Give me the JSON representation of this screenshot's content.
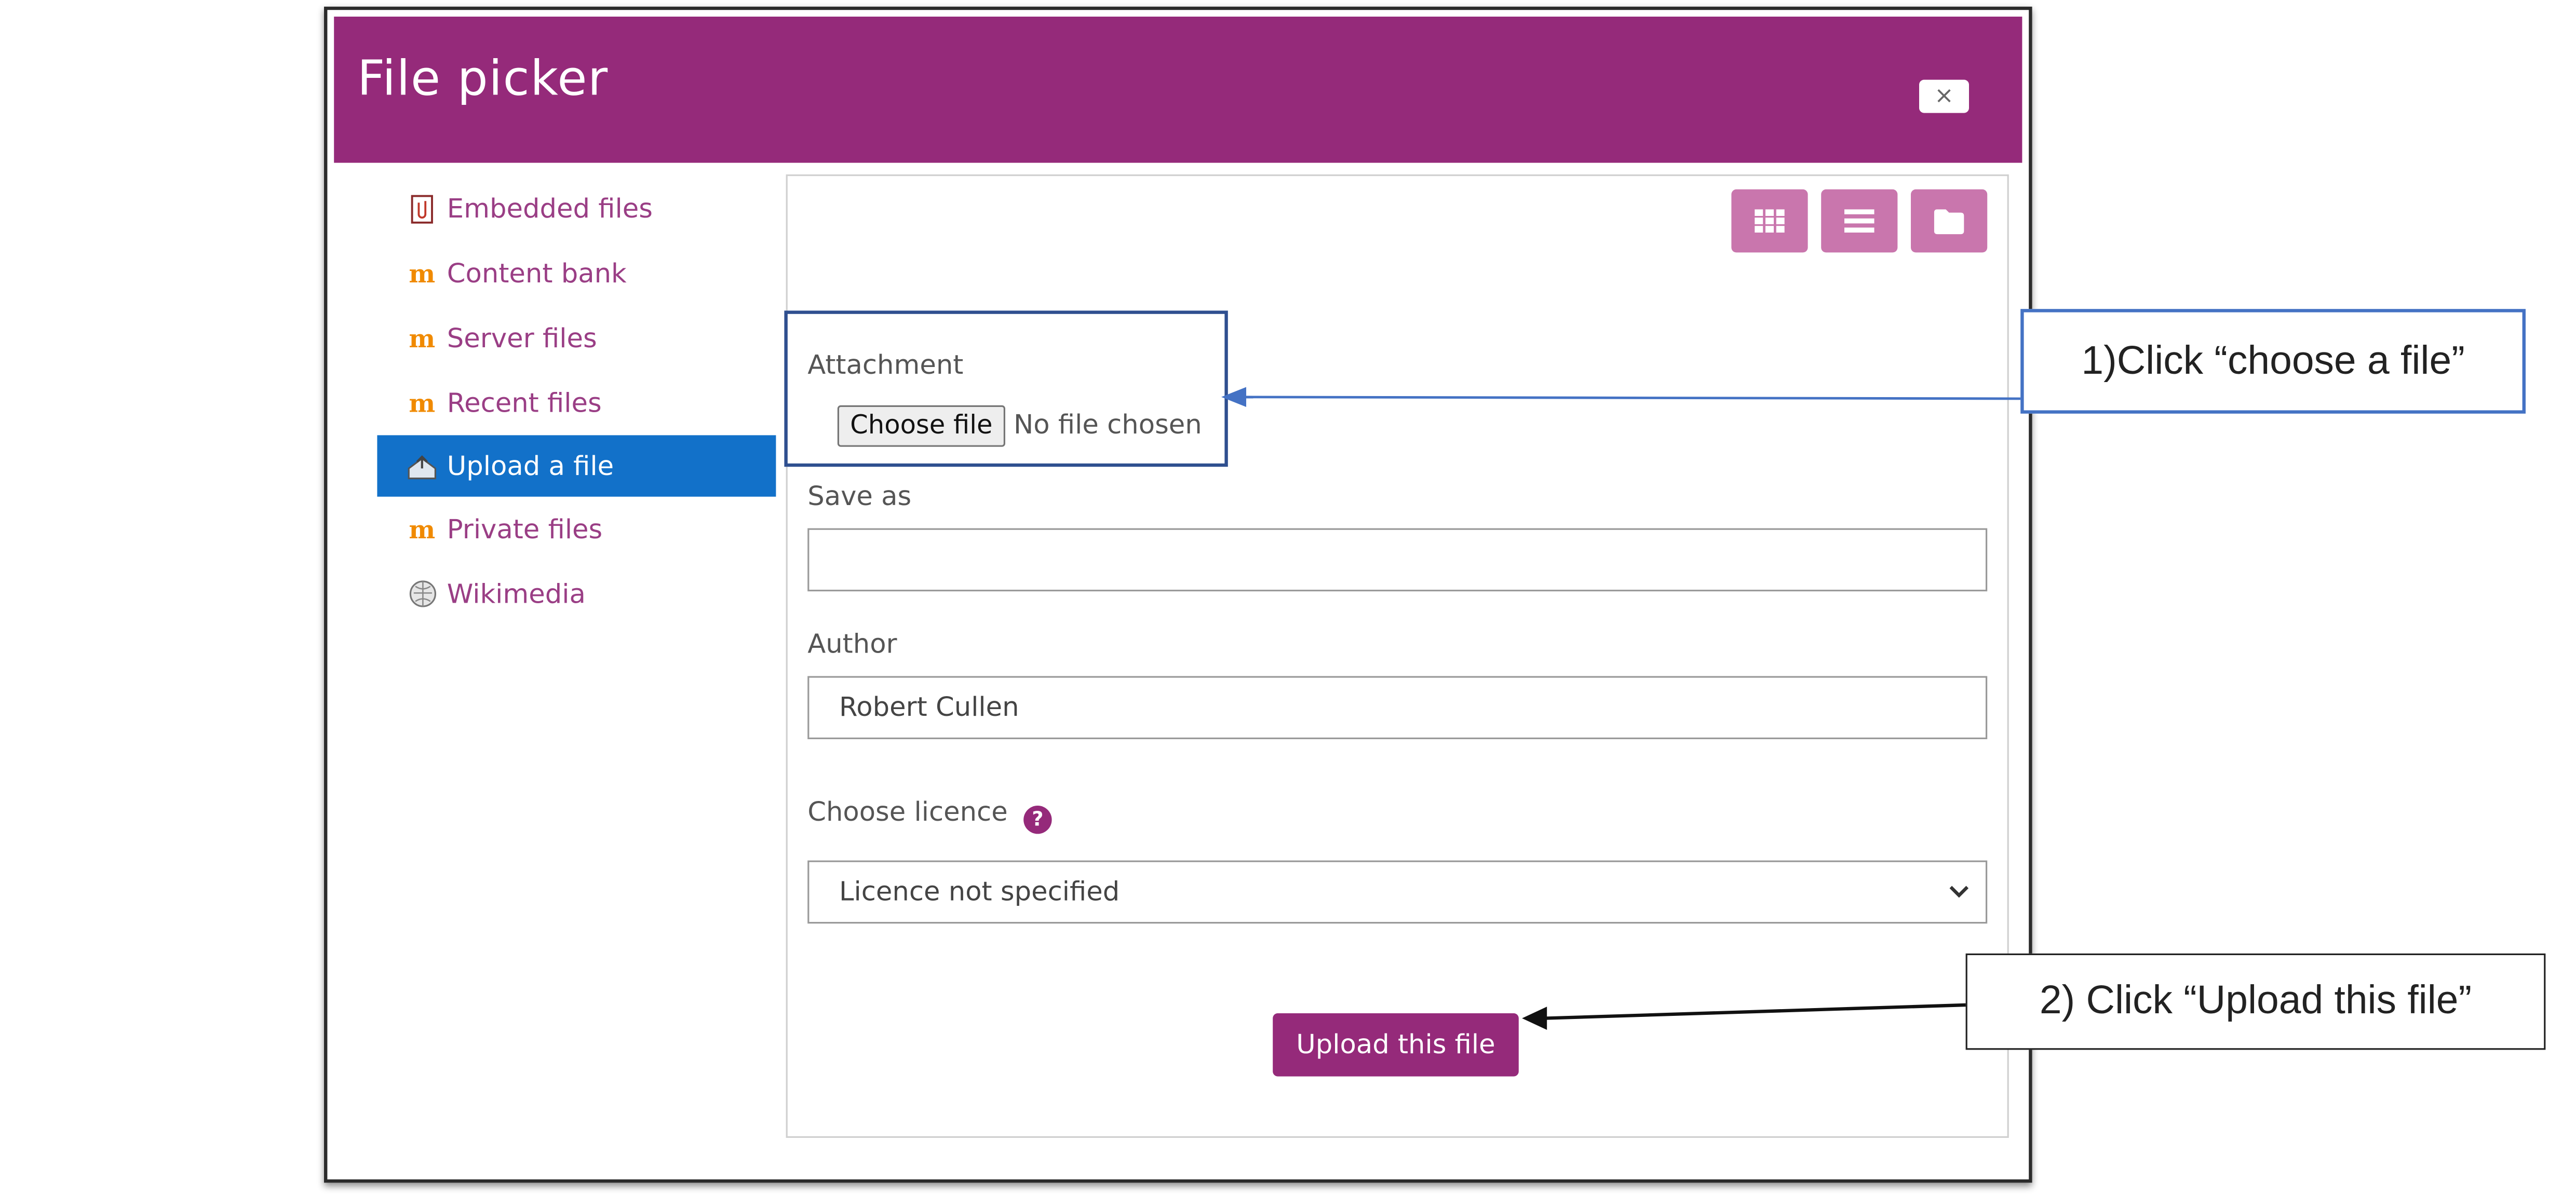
{
  "dialog": {
    "title": "File picker",
    "close_label": "×"
  },
  "sidebar": {
    "items": [
      {
        "label": "Embedded files",
        "icon": "file-attachment-icon",
        "active": false
      },
      {
        "label": "Content bank",
        "icon": "moodle-icon",
        "active": false
      },
      {
        "label": "Server files",
        "icon": "moodle-icon",
        "active": false
      },
      {
        "label": "Recent files",
        "icon": "moodle-icon",
        "active": false
      },
      {
        "label": "Upload a file",
        "icon": "upload-icon",
        "active": true
      },
      {
        "label": "Private files",
        "icon": "moodle-icon",
        "active": false
      },
      {
        "label": "Wikimedia",
        "icon": "wikimedia-icon",
        "active": false
      }
    ]
  },
  "toolbar": {
    "views": [
      "grid-view-icon",
      "list-view-icon",
      "folder-view-icon"
    ]
  },
  "form": {
    "attachment_label": "Attachment",
    "choose_file_label": "Choose file",
    "no_file_text": "No file chosen",
    "save_as_label": "Save as",
    "save_as_value": "",
    "author_label": "Author",
    "author_value": "Robert Cullen",
    "licence_label": "Choose licence",
    "licence_value": "Licence not specified",
    "upload_label": "Upload this file"
  },
  "annotations": {
    "step1": "1)Click “choose a file”",
    "step2": "2) Click “Upload this file”"
  },
  "colors": {
    "header": "#952a7a",
    "active_item": "#1271c9",
    "link": "#9a3e85",
    "view_button": "#c976ad",
    "callout_border": "#4472c4"
  }
}
